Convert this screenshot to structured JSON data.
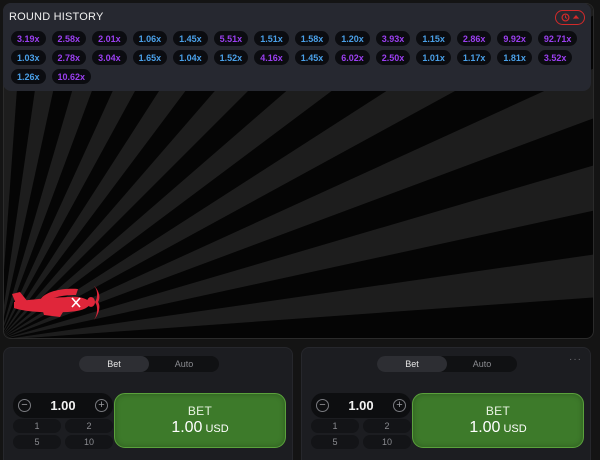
{
  "history": {
    "title": "ROUND HISTORY",
    "multipliers": [
      {
        "value": "3.19x",
        "color": "purple"
      },
      {
        "value": "2.58x",
        "color": "purple"
      },
      {
        "value": "2.01x",
        "color": "purple"
      },
      {
        "value": "1.06x",
        "color": "blue"
      },
      {
        "value": "1.45x",
        "color": "blue"
      },
      {
        "value": "5.51x",
        "color": "purple"
      },
      {
        "value": "1.51x",
        "color": "blue"
      },
      {
        "value": "1.58x",
        "color": "blue"
      },
      {
        "value": "1.20x",
        "color": "blue"
      },
      {
        "value": "3.93x",
        "color": "purple"
      },
      {
        "value": "1.15x",
        "color": "blue"
      },
      {
        "value": "2.86x",
        "color": "purple"
      },
      {
        "value": "9.92x",
        "color": "purple"
      },
      {
        "value": "92.71x",
        "color": "purple"
      },
      {
        "value": "1.03x",
        "color": "blue"
      },
      {
        "value": "2.78x",
        "color": "purple"
      },
      {
        "value": "3.04x",
        "color": "purple"
      },
      {
        "value": "1.65x",
        "color": "blue"
      },
      {
        "value": "1.04x",
        "color": "blue"
      },
      {
        "value": "1.52x",
        "color": "blue"
      },
      {
        "value": "4.16x",
        "color": "purple"
      },
      {
        "value": "1.45x",
        "color": "blue"
      },
      {
        "value": "6.02x",
        "color": "purple"
      },
      {
        "value": "2.50x",
        "color": "purple"
      },
      {
        "value": "1.01x",
        "color": "blue"
      },
      {
        "value": "1.17x",
        "color": "blue"
      },
      {
        "value": "1.81x",
        "color": "blue"
      },
      {
        "value": "3.52x",
        "color": "purple"
      },
      {
        "value": "1.26x",
        "color": "blue"
      },
      {
        "value": "10.62x",
        "color": "purple"
      }
    ]
  },
  "bet_panels": [
    {
      "tabs": [
        "Bet",
        "Auto"
      ],
      "active_tab": "Bet",
      "stake": "1.00",
      "quick_amounts": [
        "1",
        "2",
        "5",
        "10"
      ],
      "bet_label": "BET",
      "bet_amount": "1.00",
      "currency": "USD",
      "show_menu": false
    },
    {
      "tabs": [
        "Bet",
        "Auto"
      ],
      "active_tab": "Bet",
      "stake": "1.00",
      "quick_amounts": [
        "1",
        "2",
        "5",
        "10"
      ],
      "bet_label": "BET",
      "bet_amount": "1.00",
      "currency": "USD",
      "show_menu": true
    }
  ],
  "colors": {
    "accent_red": "#e0263a",
    "bet_green": "#3d7a2a",
    "chip_blue": "#4aa0e8",
    "chip_purple": "#9b3ff0"
  },
  "icons": {
    "history_toggle": "history-clock-icon",
    "plane": "plane-icon",
    "minus": "minus-icon",
    "plus": "plus-icon"
  }
}
